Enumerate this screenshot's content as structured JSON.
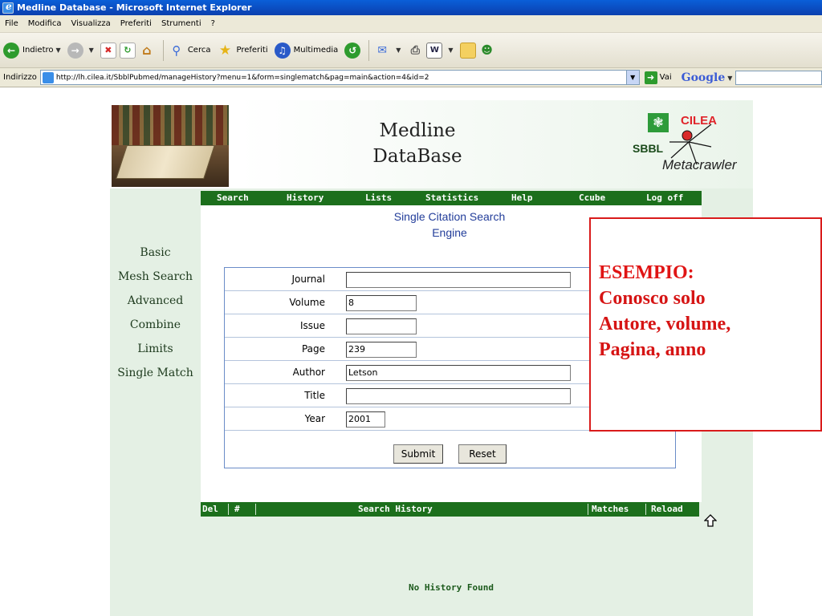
{
  "window": {
    "title": "Medline Database - Microsoft Internet Explorer"
  },
  "menu": [
    "File",
    "Modifica",
    "Visualizza",
    "Preferiti",
    "Strumenti",
    "?"
  ],
  "toolbar": {
    "back": "Indietro",
    "search": "Cerca",
    "favorites": "Preferiti",
    "media": "Multimedia"
  },
  "address": {
    "label": "Indirizzo",
    "url": "http://lh.cilea.it/SbblPubmed/manageHistory?menu=1&form=singlematch&pag=main&action=4&id=2",
    "go": "Vai",
    "google": "Google"
  },
  "site": {
    "title_line1": "Medline",
    "title_line2": "DataBase",
    "logo_cilea": "CILEA",
    "logo_sbbl": "SBBL",
    "logo_meta": "Metacrawler"
  },
  "nav": [
    "Search",
    "History",
    "Lists",
    "Statistics",
    "Help",
    "Ccube",
    "Log off"
  ],
  "heading": {
    "line1": "Single Citation Search",
    "line2": "Engine"
  },
  "sidebar": [
    "Basic",
    "Mesh Search",
    "Advanced",
    "Combine",
    "Limits",
    "Single Match"
  ],
  "form": {
    "fields": [
      {
        "label": "Journal",
        "value": ""
      },
      {
        "label": "Volume",
        "value": "8"
      },
      {
        "label": "Issue",
        "value": ""
      },
      {
        "label": "Page",
        "value": "239"
      },
      {
        "label": "Author",
        "value": "Letson"
      },
      {
        "label": "Title",
        "value": ""
      },
      {
        "label": "Year",
        "value": "2001"
      }
    ],
    "submit": "Submit",
    "reset": "Reset"
  },
  "history": {
    "col_del": "Del",
    "col_num": "#",
    "col_title": "Search History",
    "col_matches": "Matches",
    "col_reload": "Reload",
    "empty": "No History Found"
  },
  "callout": {
    "line1": "ESEMPIO:",
    "line2": "Conosco solo",
    "line3": "Autore, volume,",
    "line4": "Pagina, anno"
  }
}
